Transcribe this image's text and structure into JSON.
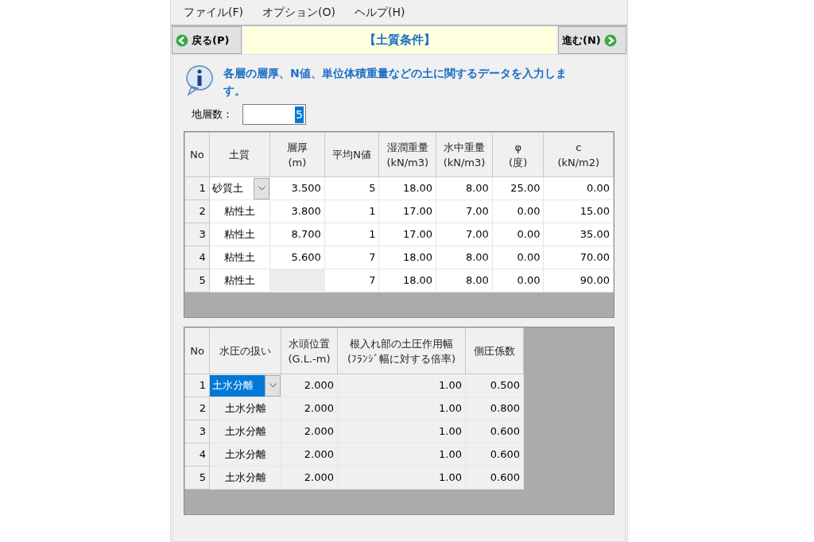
{
  "menu": [
    "ファイル(F)",
    "オプション(O)",
    "ヘルプ(H)"
  ],
  "nav": {
    "back": "戻る(P)",
    "title": "【土質条件】",
    "next": "進む(N)"
  },
  "info": "各層の層厚、N値、単位体積重量などの土に関するデータを入力します。",
  "layer_count": {
    "label": "地層数：",
    "value": "5",
    "value_selected": true
  },
  "soil_table": {
    "columns": [
      "No",
      "土質",
      "層厚\n(m)",
      "平均N値",
      "湿潤重量\n(kN/m3)",
      "水中重量\n(kN/m3)",
      "φ\n(度)",
      "c\n(kN/m2)"
    ],
    "rows": [
      {
        "active": true,
        "cells": [
          "1",
          "砂質土",
          "3.500",
          "5",
          "18.00",
          "8.00",
          "25.00",
          "0.00"
        ]
      },
      {
        "active": false,
        "cells": [
          "2",
          "粘性土",
          "3.800",
          "1",
          "17.00",
          "7.00",
          "0.00",
          "15.00"
        ]
      },
      {
        "active": false,
        "cells": [
          "3",
          "粘性土",
          "8.700",
          "1",
          "17.00",
          "7.00",
          "0.00",
          "35.00"
        ]
      },
      {
        "active": false,
        "cells": [
          "4",
          "粘性土",
          "5.600",
          "7",
          "18.00",
          "8.00",
          "0.00",
          "70.00"
        ]
      },
      {
        "active": false,
        "cells": [
          "5",
          "粘性土",
          null,
          "7",
          "18.00",
          "8.00",
          "0.00",
          "90.00"
        ]
      }
    ]
  },
  "water_table": {
    "columns": [
      "No",
      "水圧の扱い",
      "水頭位置\n(G.L.-m)",
      "根入れ部の土圧作用幅\n(ﾌﾗﾝｼﾞ幅に対する倍率)",
      "側圧係数"
    ],
    "rows": [
      {
        "active": true,
        "selected": true,
        "cells": [
          "1",
          "土水分離",
          "2.000",
          "1.00",
          "0.500"
        ]
      },
      {
        "active": false,
        "selected": false,
        "cells": [
          "2",
          "土水分離",
          "2.000",
          "1.00",
          "0.800"
        ]
      },
      {
        "active": false,
        "selected": false,
        "cells": [
          "3",
          "土水分離",
          "2.000",
          "1.00",
          "0.600"
        ]
      },
      {
        "active": false,
        "selected": false,
        "cells": [
          "4",
          "土水分離",
          "2.000",
          "1.00",
          "0.600"
        ]
      },
      {
        "active": false,
        "selected": false,
        "cells": [
          "5",
          "土水分離",
          "2.000",
          "1.00",
          "0.600"
        ]
      }
    ]
  }
}
